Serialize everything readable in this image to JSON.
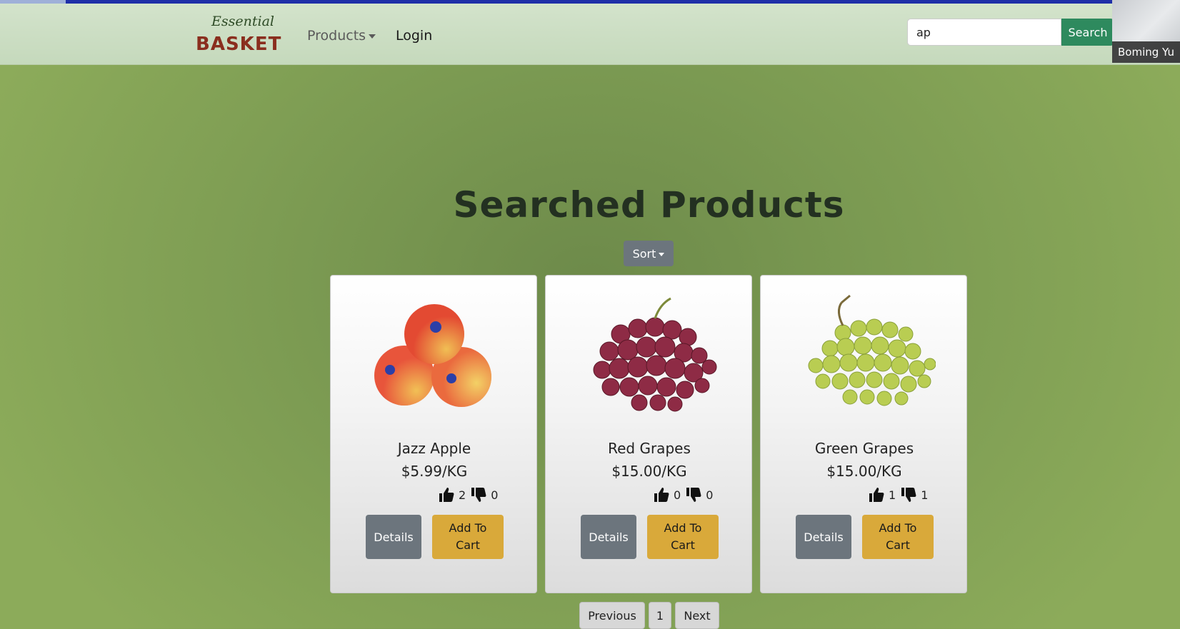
{
  "logo": {
    "script": "Essential",
    "main": "BASKET"
  },
  "nav": {
    "products": "Products",
    "login": "Login"
  },
  "search": {
    "value": "ap",
    "button": "Search"
  },
  "video": {
    "name": "Boming Yu"
  },
  "page": {
    "title": "Searched Products",
    "sort": "Sort"
  },
  "products": [
    {
      "name": "Jazz Apple",
      "price": "$5.99/KG",
      "likes": "2",
      "dislikes": "0",
      "details": "Details",
      "add_to_cart": "Add To Cart"
    },
    {
      "name": "Red Grapes",
      "price": "$15.00/KG",
      "likes": "0",
      "dislikes": "0",
      "details": "Details",
      "add_to_cart": "Add To Cart"
    },
    {
      "name": "Green Grapes",
      "price": "$15.00/KG",
      "likes": "1",
      "dislikes": "1",
      "details": "Details",
      "add_to_cart": "Add To Cart"
    }
  ],
  "pagination": {
    "previous": "Previous",
    "current": "1",
    "next": "Next"
  },
  "colors": {
    "search_button": "#2e8a5e",
    "add_to_cart": "#d9a93a",
    "details": "#6c757d",
    "top_border": "#1f2fa8"
  }
}
